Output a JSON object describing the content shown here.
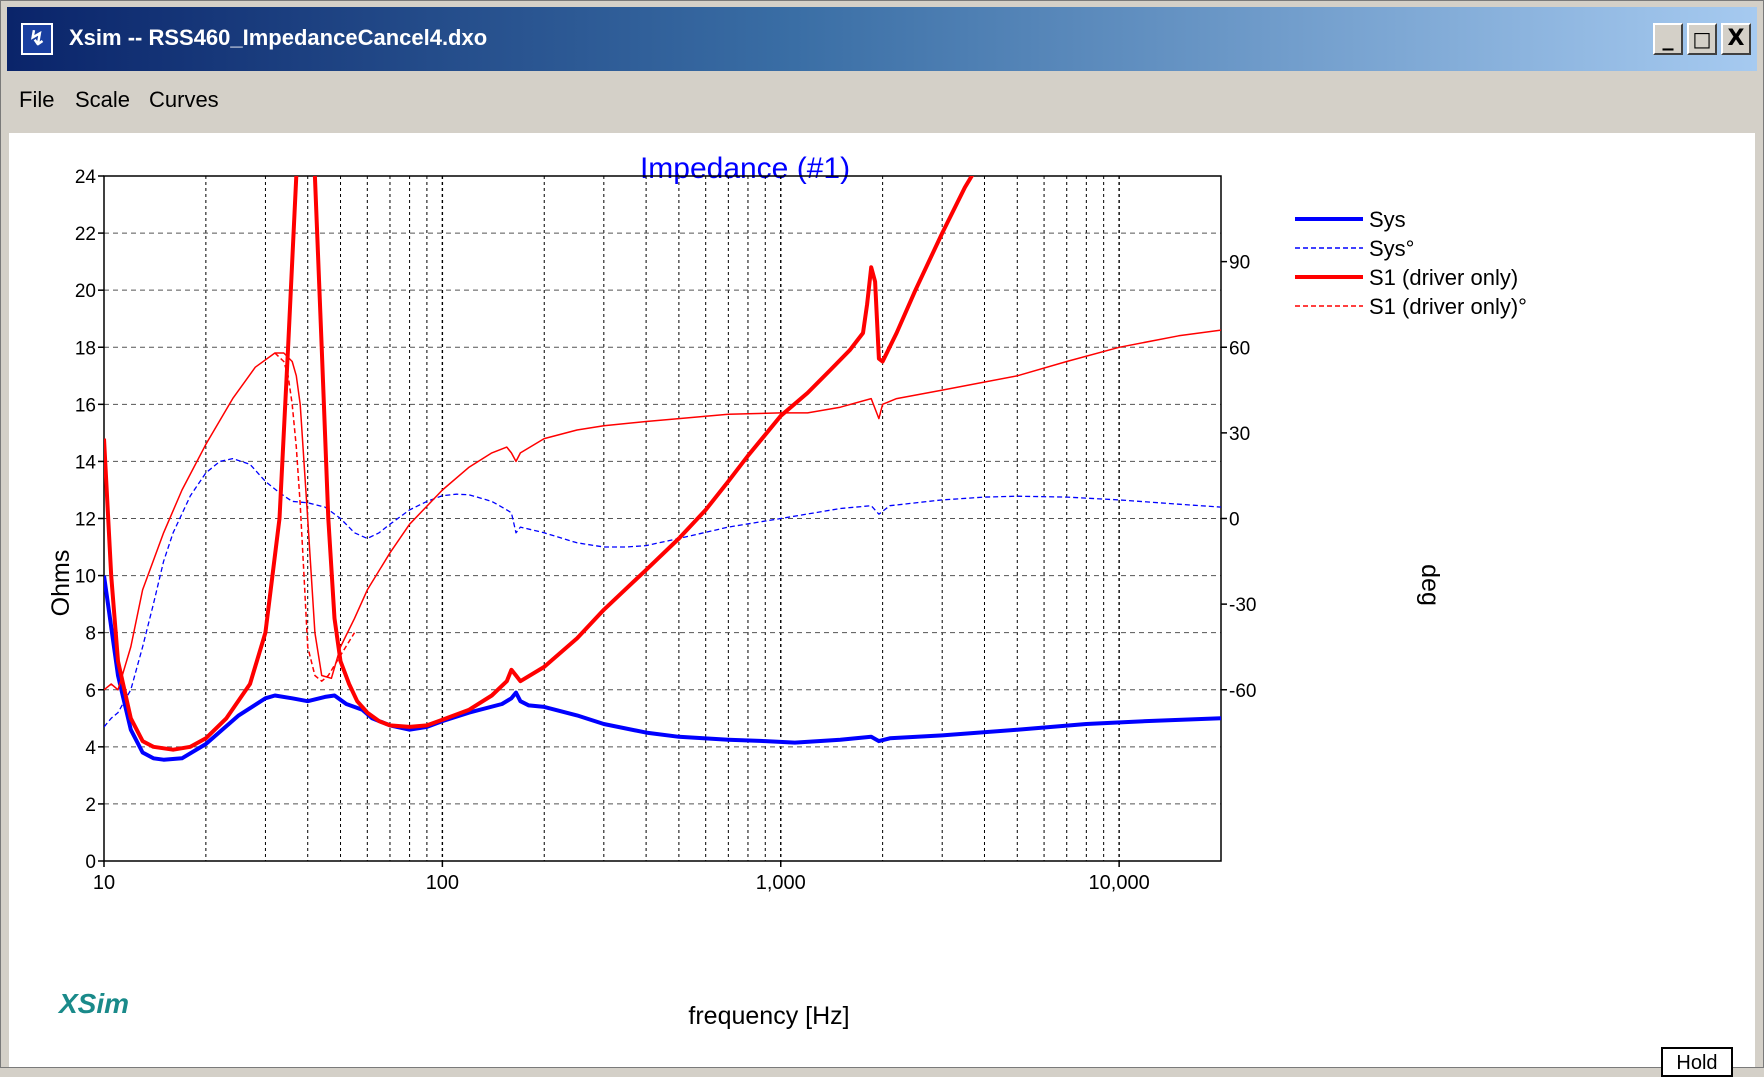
{
  "window": {
    "title": "Xsim -- RSS460_ImpedanceCancel4.dxo",
    "icon": "app-chart-icon",
    "controls": {
      "minimize": "_",
      "maximize": "□",
      "close": "X"
    }
  },
  "menu": [
    "File",
    "Scale",
    "Curves"
  ],
  "branding": "XSim",
  "hold_button": "Hold",
  "chart_data": {
    "type": "line",
    "title": "Impedance (#1)",
    "xlabel": "frequency [Hz]",
    "ylabel": "Ohms",
    "y2label": "deg",
    "x_scale": "log",
    "xlim": [
      10,
      20000
    ],
    "ylim": [
      0,
      24
    ],
    "y2lim": [
      -120,
      120
    ],
    "x_tick_labels": [
      {
        "value": 10,
        "label": "10"
      },
      {
        "value": 100,
        "label": "100"
      },
      {
        "value": 1000,
        "label": "1,000"
      },
      {
        "value": 10000,
        "label": "10,000"
      }
    ],
    "y_ticks": [
      0,
      2,
      4,
      6,
      8,
      10,
      12,
      14,
      16,
      18,
      20,
      22,
      24
    ],
    "y2_ticks": [
      -60,
      -30,
      0,
      30,
      60,
      90
    ],
    "grid": true,
    "legend_position": "right",
    "series": [
      {
        "name": "Sys",
        "axis": "left",
        "color": "#0000ff",
        "style": "solid",
        "width": 4,
        "points": [
          [
            10,
            10
          ],
          [
            11,
            6.5
          ],
          [
            12,
            4.6
          ],
          [
            13,
            3.8
          ],
          [
            14,
            3.6
          ],
          [
            15,
            3.55
          ],
          [
            17,
            3.6
          ],
          [
            20,
            4.1
          ],
          [
            25,
            5.1
          ],
          [
            30,
            5.7
          ],
          [
            32,
            5.8
          ],
          [
            36,
            5.7
          ],
          [
            40,
            5.6
          ],
          [
            45,
            5.75
          ],
          [
            48,
            5.8
          ],
          [
            52,
            5.5
          ],
          [
            58,
            5.3
          ],
          [
            62,
            5.0
          ],
          [
            70,
            4.75
          ],
          [
            80,
            4.6
          ],
          [
            90,
            4.7
          ],
          [
            100,
            4.9
          ],
          [
            120,
            5.2
          ],
          [
            150,
            5.5
          ],
          [
            160,
            5.7
          ],
          [
            165,
            5.9
          ],
          [
            170,
            5.6
          ],
          [
            180,
            5.45
          ],
          [
            200,
            5.4
          ],
          [
            250,
            5.1
          ],
          [
            300,
            4.8
          ],
          [
            400,
            4.5
          ],
          [
            500,
            4.35
          ],
          [
            700,
            4.25
          ],
          [
            900,
            4.2
          ],
          [
            1100,
            4.15
          ],
          [
            1500,
            4.25
          ],
          [
            1850,
            4.35
          ],
          [
            1950,
            4.2
          ],
          [
            2100,
            4.3
          ],
          [
            3000,
            4.4
          ],
          [
            5000,
            4.6
          ],
          [
            8000,
            4.8
          ],
          [
            12000,
            4.9
          ],
          [
            20000,
            5.0
          ]
        ]
      },
      {
        "name": "Sys°",
        "axis": "right",
        "color": "#0000ff",
        "style": "dashed",
        "width": 1.3,
        "points": [
          [
            10,
            -73
          ],
          [
            10.5,
            -70
          ],
          [
            11,
            -68
          ],
          [
            12,
            -60
          ],
          [
            13,
            -45
          ],
          [
            14,
            -30
          ],
          [
            15,
            -15
          ],
          [
            16,
            -5
          ],
          [
            18,
            8
          ],
          [
            20,
            16
          ],
          [
            22,
            20
          ],
          [
            24,
            21
          ],
          [
            27,
            19
          ],
          [
            30,
            13
          ],
          [
            33,
            9
          ],
          [
            36,
            6
          ],
          [
            40,
            5.5
          ],
          [
            45,
            4
          ],
          [
            50,
            0
          ],
          [
            55,
            -5
          ],
          [
            60,
            -7
          ],
          [
            65,
            -5
          ],
          [
            70,
            -2
          ],
          [
            80,
            3
          ],
          [
            90,
            6
          ],
          [
            100,
            8
          ],
          [
            110,
            8.5
          ],
          [
            120,
            8.3
          ],
          [
            140,
            6
          ],
          [
            155,
            3
          ],
          [
            160,
            2
          ],
          [
            165,
            -5
          ],
          [
            170,
            -3
          ],
          [
            200,
            -5
          ],
          [
            250,
            -8.5
          ],
          [
            300,
            -10
          ],
          [
            350,
            -10
          ],
          [
            400,
            -9.5
          ],
          [
            500,
            -7
          ],
          [
            700,
            -3
          ],
          [
            1000,
            0
          ],
          [
            1500,
            3.5
          ],
          [
            1850,
            4.5
          ],
          [
            1950,
            1.5
          ],
          [
            2100,
            4.5
          ],
          [
            3000,
            6.5
          ],
          [
            4000,
            7.5
          ],
          [
            5000,
            7.8
          ],
          [
            7000,
            7.5
          ],
          [
            10000,
            6.5
          ],
          [
            15000,
            5
          ],
          [
            20000,
            4
          ]
        ]
      },
      {
        "name": "S1 (driver only)",
        "axis": "left",
        "color": "#ff0000",
        "style": "solid",
        "width": 4,
        "points": [
          [
            10,
            14.8
          ],
          [
            10.5,
            10
          ],
          [
            11,
            7
          ],
          [
            12,
            5
          ],
          [
            13,
            4.2
          ],
          [
            14,
            4.0
          ],
          [
            16,
            3.9
          ],
          [
            18,
            4.0
          ],
          [
            20,
            4.3
          ],
          [
            23,
            5.0
          ],
          [
            27,
            6.2
          ],
          [
            30,
            8
          ],
          [
            33,
            12
          ],
          [
            35,
            18
          ],
          [
            37,
            24
          ],
          [
            37.8,
            26
          ],
          [
            41,
            26
          ],
          [
            42,
            24
          ],
          [
            44,
            18
          ],
          [
            46,
            12
          ],
          [
            48,
            8.5
          ],
          [
            50,
            7
          ],
          [
            53,
            6.2
          ],
          [
            56,
            5.6
          ],
          [
            60,
            5.2
          ],
          [
            65,
            4.9
          ],
          [
            70,
            4.75
          ],
          [
            80,
            4.7
          ],
          [
            90,
            4.75
          ],
          [
            100,
            4.95
          ],
          [
            120,
            5.3
          ],
          [
            140,
            5.8
          ],
          [
            155,
            6.3
          ],
          [
            160,
            6.7
          ],
          [
            165,
            6.5
          ],
          [
            170,
            6.3
          ],
          [
            200,
            6.8
          ],
          [
            250,
            7.8
          ],
          [
            300,
            8.8
          ],
          [
            400,
            10.2
          ],
          [
            500,
            11.3
          ],
          [
            600,
            12.3
          ],
          [
            700,
            13.3
          ],
          [
            800,
            14.2
          ],
          [
            1000,
            15.6
          ],
          [
            1200,
            16.4
          ],
          [
            1400,
            17.2
          ],
          [
            1600,
            17.9
          ],
          [
            1750,
            18.5
          ],
          [
            1800,
            19.5
          ],
          [
            1850,
            20.8
          ],
          [
            1900,
            20.3
          ],
          [
            1950,
            17.6
          ],
          [
            2000,
            17.5
          ],
          [
            2200,
            18.5
          ],
          [
            2500,
            20
          ],
          [
            3000,
            22
          ],
          [
            3500,
            23.6
          ],
          [
            3800,
            24.3
          ]
        ]
      },
      {
        "name": "S1 (driver only)°",
        "axis": "right",
        "color": "#ff0000",
        "style": "solid",
        "width": 1.5,
        "points": [
          [
            10,
            -60
          ],
          [
            10.5,
            -58
          ],
          [
            11,
            -60
          ],
          [
            12,
            -45
          ],
          [
            13,
            -25
          ],
          [
            15,
            -5
          ],
          [
            17,
            10
          ],
          [
            20,
            26
          ],
          [
            24,
            42
          ],
          [
            28,
            53
          ],
          [
            32,
            58
          ],
          [
            34,
            58
          ],
          [
            36,
            55
          ],
          [
            37,
            50
          ],
          [
            38,
            40
          ],
          [
            40,
            0
          ],
          [
            42,
            -40
          ],
          [
            44,
            -55
          ],
          [
            47,
            -56
          ],
          [
            50,
            -45
          ],
          [
            55,
            -35
          ],
          [
            60,
            -25
          ],
          [
            70,
            -12
          ],
          [
            80,
            -2
          ],
          [
            100,
            10
          ],
          [
            120,
            18
          ],
          [
            140,
            23
          ],
          [
            155,
            25
          ],
          [
            160,
            23
          ],
          [
            165,
            20
          ],
          [
            170,
            23
          ],
          [
            200,
            28
          ],
          [
            250,
            31
          ],
          [
            300,
            32.5
          ],
          [
            400,
            34
          ],
          [
            500,
            35
          ],
          [
            700,
            36.5
          ],
          [
            1000,
            37
          ],
          [
            1200,
            37
          ],
          [
            1500,
            39
          ],
          [
            1850,
            42
          ],
          [
            1950,
            35
          ],
          [
            2000,
            40
          ],
          [
            2200,
            42
          ],
          [
            3000,
            45
          ],
          [
            5000,
            50
          ],
          [
            7000,
            55
          ],
          [
            10000,
            60
          ],
          [
            15000,
            64
          ],
          [
            20000,
            66
          ]
        ]
      },
      {
        "name": "",
        "axis": "right",
        "color": "#ff0000",
        "style": "dashed",
        "width": 1.5,
        "points": [
          [
            32,
            58
          ],
          [
            34,
            55
          ],
          [
            35,
            50
          ],
          [
            36,
            40
          ],
          [
            37,
            25
          ],
          [
            38,
            5
          ],
          [
            39,
            -20
          ],
          [
            40,
            -45
          ],
          [
            42,
            -55
          ],
          [
            44,
            -57
          ],
          [
            46,
            -55
          ],
          [
            50,
            -48
          ],
          [
            55,
            -40
          ]
        ]
      }
    ],
    "legend": [
      {
        "name": "Sys",
        "color": "#0000ff",
        "style": "solid",
        "width": 4
      },
      {
        "name": "Sys°",
        "color": "#0000ff",
        "style": "dashed",
        "width": 1.5
      },
      {
        "name": "S1 (driver only)",
        "color": "#ff0000",
        "style": "solid",
        "width": 4
      },
      {
        "name": "S1 (driver only)°",
        "color": "#ff0000",
        "style": "dashed",
        "width": 1.5
      }
    ]
  }
}
